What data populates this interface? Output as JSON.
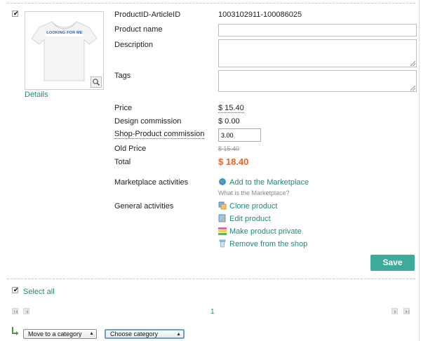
{
  "product": {
    "id_label": "ProductID-ArticleID",
    "id_value": "1003102911-100086025",
    "name_label": "Product name",
    "name_value": "",
    "description_label": "Description",
    "description_value": "",
    "tags_label": "Tags",
    "tags_value": "",
    "details_link": "Details",
    "thumbnail_icon": "tshirt-icon",
    "shirt_slogan": "LOOKING FOR ME"
  },
  "pricing": {
    "price_label": "Price",
    "price_value": "$ 15.40",
    "design_commission_label": "Design commission",
    "design_commission_value": "$ 0.00",
    "shop_commission_label": "Shop-Product commission",
    "shop_commission_value": "3.00",
    "old_price_label": "Old Price",
    "old_price_value": "$ 15.40",
    "total_label": "Total",
    "total_value": "$ 18.40",
    "total_color": "#e8632a"
  },
  "marketplace": {
    "label": "Marketplace activities",
    "add_link": "Add to the Marketplace",
    "help_text": "What is the Marketplace?"
  },
  "general": {
    "label": "General activities",
    "actions": [
      {
        "label": "Clone product",
        "icon": "clone-icon"
      },
      {
        "label": "Edit product",
        "icon": "edit-icon"
      },
      {
        "label": "Make product private",
        "icon": "private-icon"
      },
      {
        "label": "Remove from the shop",
        "icon": "trash-icon"
      }
    ]
  },
  "buttons": {
    "save": "Save"
  },
  "bulk": {
    "select_all": "Select all",
    "page_number": "1",
    "move_select": "Move to a category",
    "category_select": "Choose category"
  },
  "colors": {
    "accent": "#3dab9b",
    "link": "#1f8a7a",
    "total": "#e8632a"
  }
}
